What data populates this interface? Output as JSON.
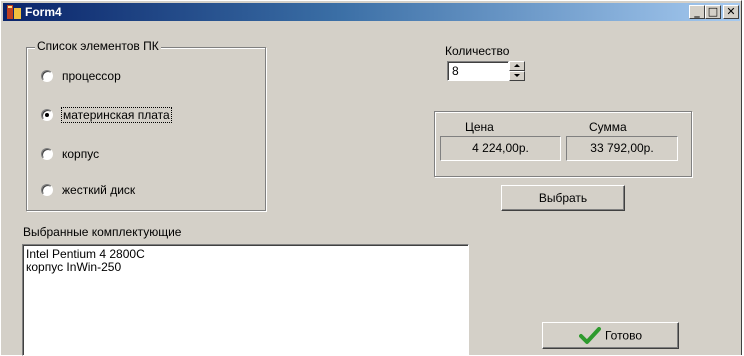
{
  "window": {
    "title": "Form4",
    "minimize_glyph": "_",
    "maximize_glyph": "□",
    "close_glyph": "✕"
  },
  "components_group": {
    "legend": "Список элементов ПК",
    "options": [
      {
        "label": "процессор",
        "selected": false
      },
      {
        "label": "материнская плата",
        "selected": true
      },
      {
        "label": "корпус",
        "selected": false
      },
      {
        "label": "жесткий диск",
        "selected": false
      }
    ]
  },
  "quantity": {
    "label": "Количество",
    "value": "8"
  },
  "price_panel": {
    "price_label": "Цена",
    "price_value": "4 224,00р.",
    "sum_label": "Сумма",
    "sum_value": "33 792,00р."
  },
  "select_button": {
    "label": "Выбрать"
  },
  "selected_list": {
    "label": "Выбранные комплектующие",
    "items": [
      "Intel Pentium 4 2800C",
      "корпус InWin-250"
    ]
  },
  "done_button": {
    "label": "Готово",
    "icon": "checkmark-icon"
  },
  "colors": {
    "checkmark": "#2e9a2e",
    "title_start": "#0a246a",
    "title_end": "#a6caf0"
  }
}
